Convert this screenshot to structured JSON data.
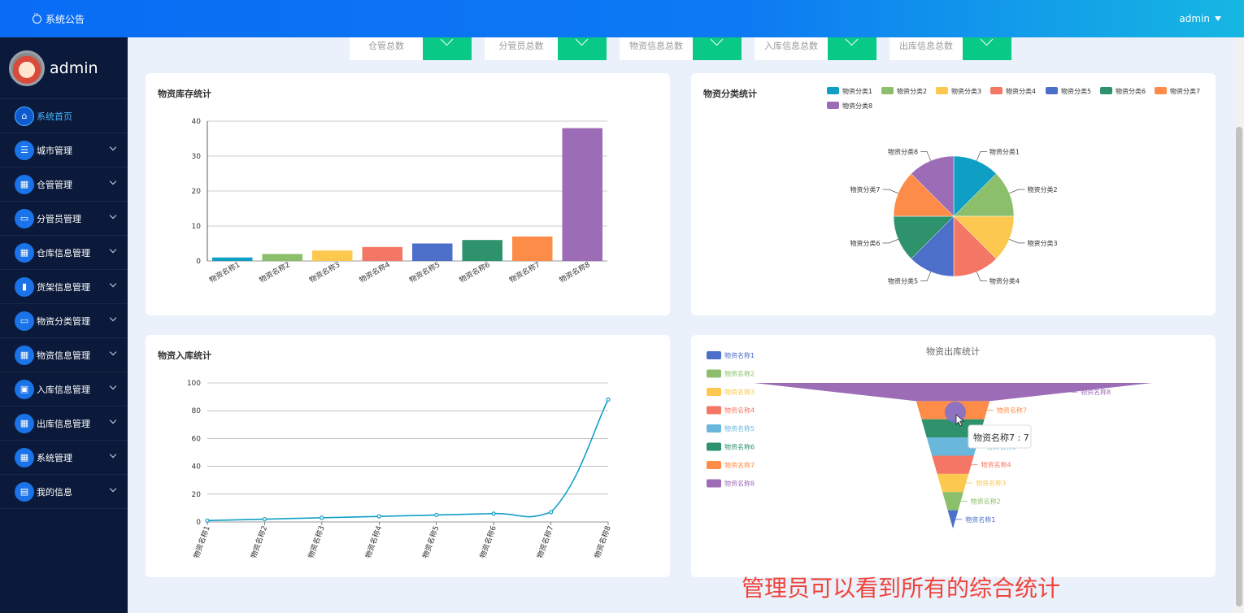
{
  "topbar": {
    "notice": "系统公告",
    "user": "admin"
  },
  "sidebar": {
    "username": "admin",
    "items": [
      {
        "label": "系统首页",
        "icon": "home-icon",
        "glyph": "⌂",
        "active": true
      },
      {
        "label": "城市管理",
        "icon": "list-icon",
        "glyph": "☰"
      },
      {
        "label": "仓管管理",
        "icon": "grid-icon",
        "glyph": "▦"
      },
      {
        "label": "分管员管理",
        "icon": "monitor-icon",
        "glyph": "▭"
      },
      {
        "label": "仓库信息管理",
        "icon": "grid-icon",
        "glyph": "▦"
      },
      {
        "label": "货架信息管理",
        "icon": "bar-chart-icon",
        "glyph": "▮"
      },
      {
        "label": "物资分类管理",
        "icon": "monitor-icon",
        "glyph": "▭"
      },
      {
        "label": "物资信息管理",
        "icon": "grid-icon",
        "glyph": "▦"
      },
      {
        "label": "入库信息管理",
        "icon": "wallet-icon",
        "glyph": "▣"
      },
      {
        "label": "出库信息管理",
        "icon": "grid-icon",
        "glyph": "▦"
      },
      {
        "label": "系统管理",
        "icon": "grid-icon",
        "glyph": "▦"
      },
      {
        "label": "我的信息",
        "icon": "card-icon",
        "glyph": "▤"
      }
    ]
  },
  "stats": [
    "仓管总数",
    "分管员总数",
    "物资信息总数",
    "入库信息总数",
    "出库信息总数"
  ],
  "colors": [
    "#0f9fc5",
    "#8cbf6b",
    "#fcc84f",
    "#f47664",
    "#4c6fc9",
    "#2e926d",
    "#fd8c48",
    "#9c6cb6"
  ],
  "bar_chart": {
    "title": "物资库存统计",
    "chart_data": {
      "type": "bar",
      "categories": [
        "物资名称1",
        "物资名称2",
        "物资名称3",
        "物资名称4",
        "物资名称5",
        "物资名称6",
        "物资名称7",
        "物资名称8"
      ],
      "values": [
        1,
        2,
        3,
        4,
        5,
        6,
        7,
        38
      ],
      "ylim": [
        0,
        40
      ],
      "yticks": [
        0,
        10,
        20,
        30,
        40
      ]
    }
  },
  "pie_chart": {
    "title": "物资分类统计",
    "chart_data": {
      "type": "pie",
      "categories": [
        "物资分类1",
        "物资分类2",
        "物资分类3",
        "物资分类4",
        "物资分类5",
        "物资分类6",
        "物资分类7",
        "物资分类8"
      ],
      "values": [
        1,
        1,
        1,
        1,
        1,
        1,
        1,
        1
      ],
      "legend": "top-right"
    }
  },
  "line_chart": {
    "title": "物资入库统计",
    "chart_data": {
      "type": "line",
      "categories": [
        "物资名称1",
        "物资名称2",
        "物资名称3",
        "物资名称4",
        "物资名称5",
        "物资名称6",
        "物资名称7",
        "物资名称8"
      ],
      "values": [
        1,
        2,
        3,
        4,
        5,
        6,
        7,
        88
      ],
      "ylim": [
        0,
        100
      ],
      "yticks": [
        0,
        20,
        40,
        60,
        80,
        100
      ]
    }
  },
  "funnel_chart": {
    "title": "物资出库统计",
    "tooltip": "物资名称7 : 7",
    "chart_data": {
      "type": "funnel",
      "categories": [
        "物资名称1",
        "物资名称2",
        "物资名称3",
        "物资名称4",
        "物资名称5",
        "物资名称6",
        "物资名称7",
        "物资名称8"
      ],
      "values": [
        1,
        2,
        3,
        4,
        5,
        6,
        7,
        38
      ],
      "legend": "left",
      "colors": [
        "#4c6fc9",
        "#8cbf6b",
        "#fcc84f",
        "#f47664",
        "#6ab7dc",
        "#2e926d",
        "#fd8c48",
        "#9c6cb6"
      ]
    }
  },
  "caption": "管理员可以看到所有的综合统计"
}
